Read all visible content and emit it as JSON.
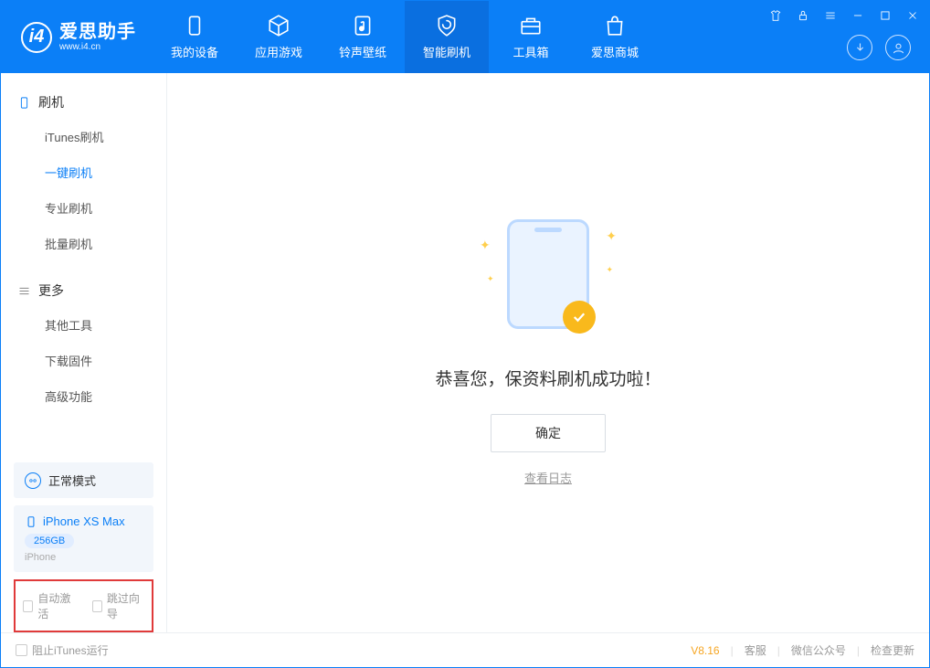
{
  "app": {
    "title": "爱思助手",
    "subtitle": "www.i4.cn"
  },
  "nav": {
    "my_device": "我的设备",
    "apps_games": "应用游戏",
    "ringtones": "铃声壁纸",
    "smart_flash": "智能刷机",
    "toolbox": "工具箱",
    "store": "爱思商城"
  },
  "sidebar": {
    "flash_heading": "刷机",
    "items": {
      "itunes": "iTunes刷机",
      "oneclick": "一键刷机",
      "pro": "专业刷机",
      "batch": "批量刷机"
    },
    "more_heading": "更多",
    "more": {
      "other_tools": "其他工具",
      "download_fw": "下载固件",
      "advanced": "高级功能"
    }
  },
  "mode": {
    "label": "正常模式"
  },
  "device": {
    "name": "iPhone XS Max",
    "capacity": "256GB",
    "type": "iPhone"
  },
  "checks": {
    "auto_activate": "自动激活",
    "skip_guide": "跳过向导"
  },
  "main": {
    "success": "恭喜您，保资料刷机成功啦！",
    "ok": "确定",
    "view_log": "查看日志"
  },
  "footer": {
    "block_itunes": "阻止iTunes运行",
    "version": "V8.16",
    "support": "客服",
    "wechat": "微信公众号",
    "check_update": "检查更新"
  }
}
